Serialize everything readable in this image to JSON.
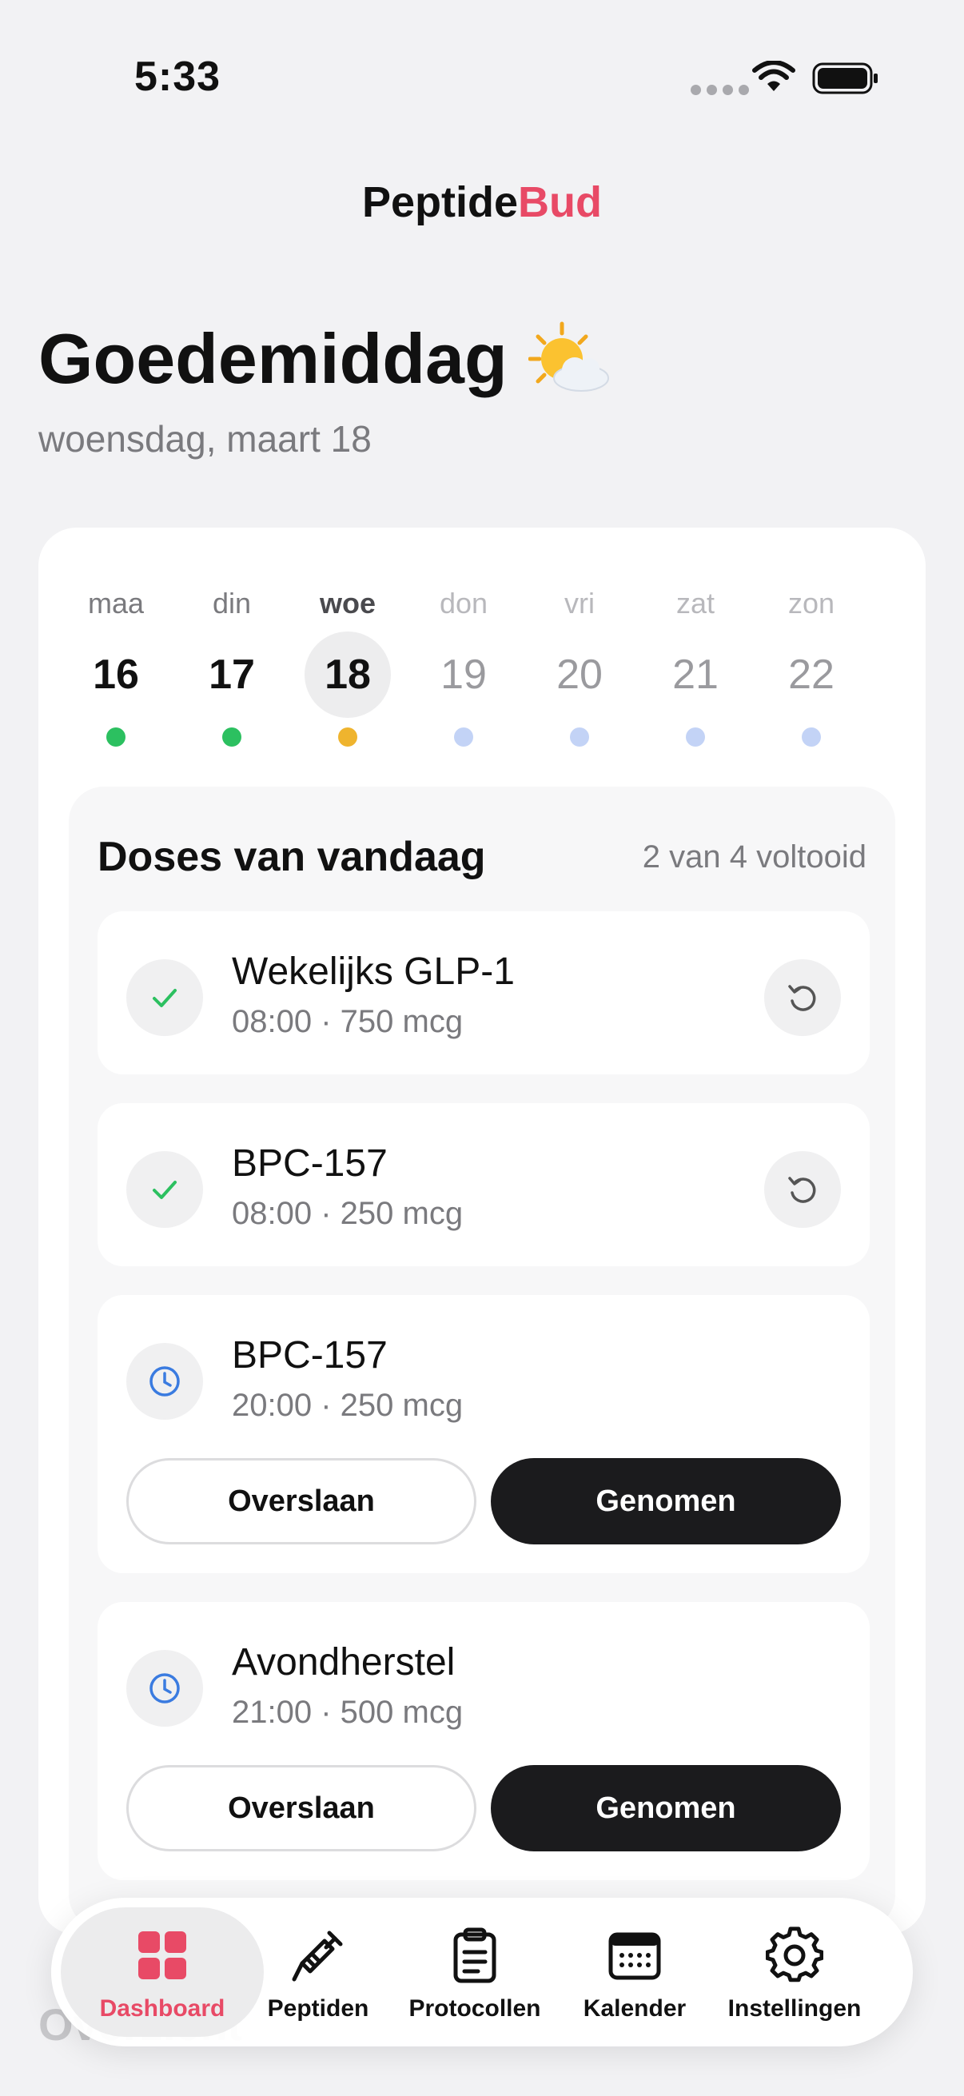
{
  "status_bar": {
    "time": "5:33"
  },
  "brand": {
    "part1": "Peptide",
    "part2": "Bud",
    "accent_color": "#e84a66"
  },
  "greeting": {
    "title": "Goedemiddag",
    "icon": "sun-behind-cloud-icon",
    "date": "woensdag, maart 18"
  },
  "week": {
    "days": [
      {
        "name": "maa",
        "num": "16",
        "status": "done"
      },
      {
        "name": "din",
        "num": "17",
        "status": "done"
      },
      {
        "name": "woe",
        "num": "18",
        "status": "partial"
      },
      {
        "name": "don",
        "num": "19",
        "status": "upcoming"
      },
      {
        "name": "vri",
        "num": "20",
        "status": "upcoming"
      },
      {
        "name": "zat",
        "num": "21",
        "status": "upcoming"
      },
      {
        "name": "zon",
        "num": "22",
        "status": "upcoming"
      }
    ],
    "status_colors": {
      "done": "#2cc060",
      "partial": "#efb42e",
      "upcoming": "#c3d3f6"
    }
  },
  "doses": {
    "title": "Doses van vandaag",
    "progress": "2 van 4 voltooid",
    "items": [
      {
        "name": "Wekelijks GLP-1",
        "detail": "08:00 · 750 mcg",
        "state": "taken"
      },
      {
        "name": "BPC-157",
        "detail": "08:00 · 250 mcg",
        "state": "taken"
      },
      {
        "name": "BPC-157",
        "detail": "20:00 · 250 mcg",
        "state": "pending"
      },
      {
        "name": "Avondherstel",
        "detail": "21:00 · 500 mcg",
        "state": "pending"
      }
    ],
    "skip_label": "Overslaan",
    "taken_label": "Genomen"
  },
  "peek_text": "Overzicht",
  "tabs": [
    {
      "label": "Dashboard",
      "icon": "grid-icon"
    },
    {
      "label": "Peptiden",
      "icon": "syringe-icon"
    },
    {
      "label": "Protocollen",
      "icon": "clipboard-icon"
    },
    {
      "label": "Kalender",
      "icon": "calendar-icon"
    },
    {
      "label": "Instellingen",
      "icon": "gear-icon"
    }
  ]
}
